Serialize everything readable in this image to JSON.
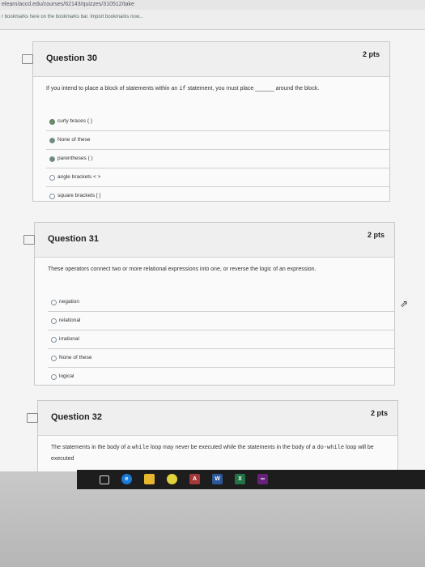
{
  "browser": {
    "url": "elearn/accd.edu/courses/62143/quizzes/310512/take",
    "bookmarks_hint": "r bookmarks here on the bookmarks bar. Import bookmarks now..."
  },
  "questions": [
    {
      "title": "Question 30",
      "points": "2 pts",
      "text_before": "If you intend to place a block of statements within an",
      "code": "if",
      "text_mid": "statement, you must place",
      "blank": "______",
      "text_after": "around the block.",
      "answers": [
        "curly braces { }",
        "None of these",
        "parentheses ( )",
        "angle brackets < >",
        "square brackets [ ]"
      ],
      "selected_index": 0
    },
    {
      "title": "Question 31",
      "points": "2 pts",
      "text": "These operators connect two or more relational expressions into one, or reverse the logic of an expression.",
      "answers": [
        "negation",
        "relational",
        "irrational",
        "None of these",
        "logical"
      ],
      "selected_index": -1
    },
    {
      "title": "Question 32",
      "points": "2 pts",
      "text_before": "The statements in the body of a",
      "code": "while",
      "text_mid": "loop may never be executed while the statements in the body of a",
      "code2": "do-while",
      "text_after": "loop will be executed"
    }
  ],
  "taskbar": {
    "icons": [
      "task-view-icon",
      "edge-icon",
      "file-explorer-icon",
      "chrome-icon",
      "access-icon",
      "word-icon",
      "excel-icon",
      "visual-studio-icon"
    ],
    "labels": {
      "access": "A",
      "word": "W",
      "excel": "X"
    },
    "colors": {
      "access": "#a4373a",
      "word": "#2b579a",
      "excel": "#217346",
      "vs": "#68217a"
    }
  },
  "colors": {
    "selected_radio": "#6b8f6b"
  }
}
